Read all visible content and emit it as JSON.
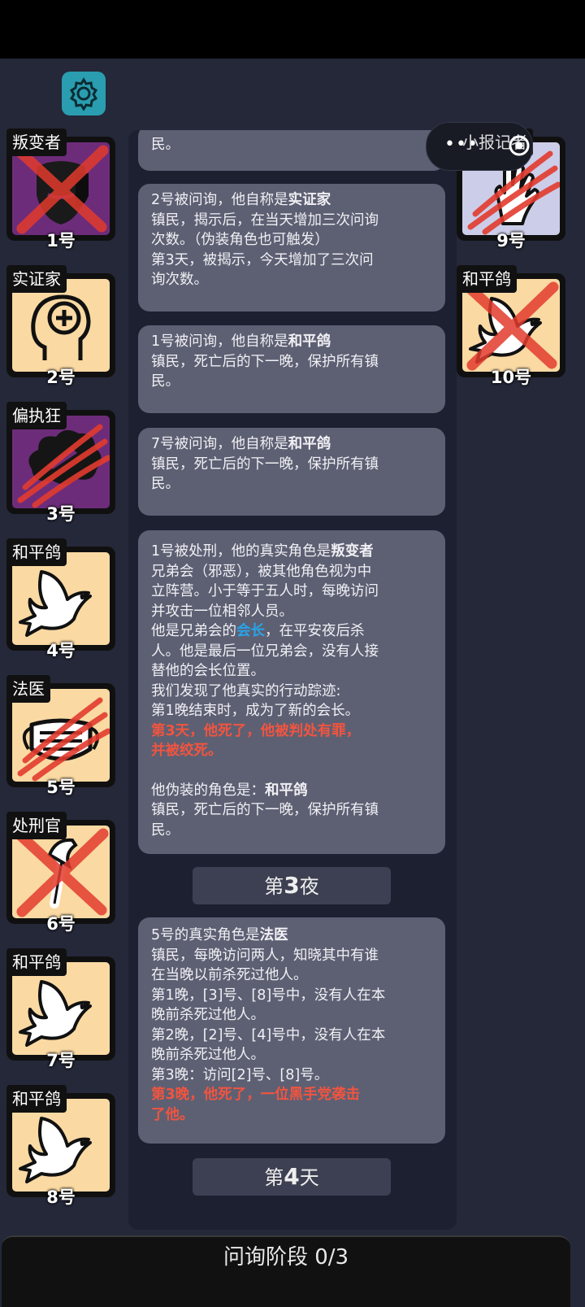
{
  "settings": {
    "icon": "gear-icon"
  },
  "left_cards": [
    {
      "label": "叛变者",
      "num": "1号",
      "bg": "purple",
      "mark": "x",
      "icon": "mask-icon"
    },
    {
      "label": "实证家",
      "num": "2号",
      "bg": "beige",
      "mark": "none",
      "icon": "head-plus-icon"
    },
    {
      "label": "偏执狂",
      "num": "3号",
      "bg": "purple",
      "mark": "claw",
      "icon": "cloud-knife-icon"
    },
    {
      "label": "和平鸽",
      "num": "4号",
      "bg": "beige",
      "mark": "none",
      "icon": "dove-icon"
    },
    {
      "label": "法医",
      "num": "5号",
      "bg": "beige",
      "mark": "claw",
      "icon": "face-mask-icon"
    },
    {
      "label": "处刑官",
      "num": "6号",
      "bg": "beige",
      "mark": "x",
      "icon": "axe-icon"
    },
    {
      "label": "和平鸽",
      "num": "7号",
      "bg": "beige",
      "mark": "none",
      "icon": "dove-icon"
    },
    {
      "label": "和平鸽",
      "num": "8号",
      "bg": "beige",
      "mark": "none",
      "icon": "dove-icon"
    }
  ],
  "right_cards": [
    {
      "label": "小报记者",
      "num": "9号",
      "bg": "lav",
      "mark": "claw",
      "icon": "hand-icon"
    },
    {
      "label": "和平鸽",
      "num": "10号",
      "bg": "beige",
      "mark": "x",
      "icon": "dove-icon"
    }
  ],
  "paper_tab": {
    "label": "小报记者",
    "dots": "•••"
  },
  "log": {
    "e0": {
      "line1": "民。"
    },
    "e1": {
      "p1": "2号被问询，他自称是",
      "role": "实证家",
      "l2": "镇民，揭示后，在当天增加三次问询",
      "l3": "次数。（伪装角色也可触发）",
      "l4": "第3天，被揭示，今天增加了三次问",
      "l5": "询次数。"
    },
    "e2": {
      "p1": "1号被问询，他自称是",
      "role": "和平鸽",
      "l2": "镇民，死亡后的下一晚，保护所有镇",
      "l3": "民。"
    },
    "e3": {
      "p1": "7号被问询，他自称是",
      "role": "和平鸽",
      "l2": "镇民，死亡后的下一晚，保护所有镇",
      "l3": "民。"
    },
    "e4": {
      "p1": "1号被处刑，他的真实角色是",
      "role": "叛变者",
      "l2": "兄弟会（邪恶），被其他角色视为中",
      "l3": "立阵营。小于等于五人时，每晚访问",
      "l4": "并攻击一位相邻人员。",
      "l5a": "他是兄弟会的",
      "l5b": "会长",
      "l5c": "，在平安夜后杀",
      "l6": "人。他是最后一位兄弟会，没有人接",
      "l7": "替他的会长位置。",
      "l8": "我们发现了他真实的行动踪迹:",
      "l9": "第1晚结束时，成为了新的会长。",
      "red1": "第3天，他死了，他被判处有罪，",
      "red2": "并被绞死。",
      "l10a": "他伪装的角色是：",
      "l10b": "和平鸽",
      "l11": "镇民，死亡后的下一晚，保护所有镇",
      "l12": "民。"
    },
    "night3": {
      "pre": "第",
      "num": "3",
      "post": "夜"
    },
    "e5": {
      "p1": "5号的真实角色是",
      "role": "法医",
      "l2": "镇民，每晚访问两人，知晓其中有谁",
      "l3": "在当晚以前杀死过他人。",
      "l4": "第1晚，[3]号、[8]号中，没有人在本",
      "l5": "晚前杀死过他人。",
      "l6": "第2晚，[2]号、[4]号中，没有人在本",
      "l7": "晚前杀死过他人。",
      "l8": "第3晚：访问[2]号、[8]号。",
      "red1": "第3晚，他死了，一位黑手党袭击",
      "red2": "了他。"
    },
    "day4": {
      "pre": "第",
      "num": "4",
      "post": "天"
    }
  },
  "phase": {
    "label": "问询阶段 0/3"
  },
  "colors": {
    "bg": "#252839",
    "panel": "#1d2030",
    "bubble": "#5d6073",
    "red": "#f2543f",
    "blue": "#29a3e8",
    "purple": "#6d2c7a",
    "beige": "#fad9a3"
  }
}
